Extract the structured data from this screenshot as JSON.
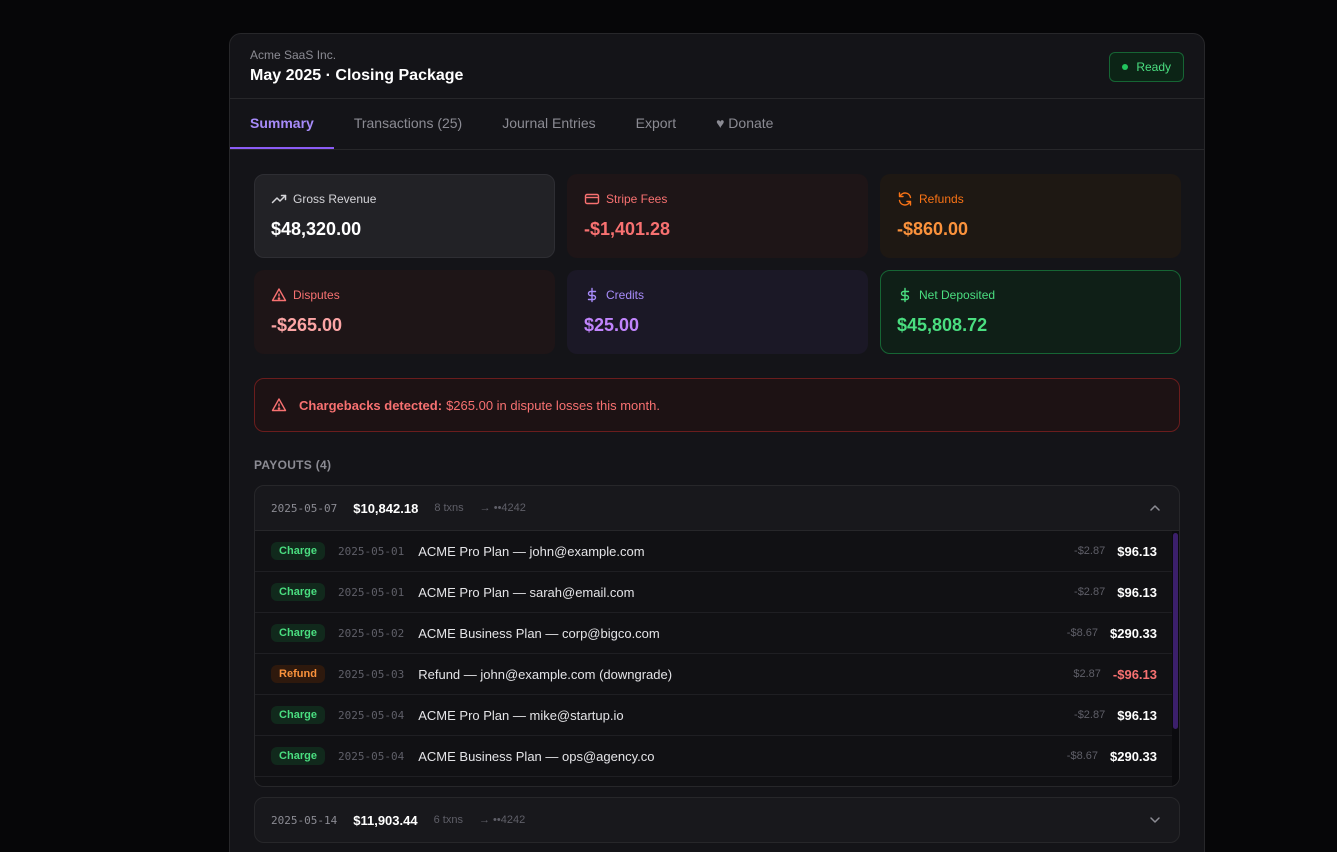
{
  "header": {
    "company": "Acme SaaS Inc.",
    "title": "May 2025 · Closing Package",
    "status": "Ready"
  },
  "tabs": [
    {
      "label": "Summary",
      "active": true
    },
    {
      "label": "Transactions (25)",
      "active": false
    },
    {
      "label": "Journal Entries",
      "active": false
    },
    {
      "label": "Export",
      "active": false
    },
    {
      "label": "♥ Donate",
      "active": false
    }
  ],
  "cards": {
    "gross": {
      "label": "Gross Revenue",
      "value": "$48,320.00",
      "icon": "trending-up-icon"
    },
    "fees": {
      "label": "Stripe Fees",
      "value": "-$1,401.28",
      "icon": "credit-card-icon"
    },
    "refunds": {
      "label": "Refunds",
      "value": "-$860.00",
      "icon": "refresh-icon"
    },
    "disputes": {
      "label": "Disputes",
      "value": "-$265.00",
      "icon": "warning-icon"
    },
    "credits": {
      "label": "Credits",
      "value": "$25.00",
      "icon": "dollar-icon"
    },
    "net": {
      "label": "Net Deposited",
      "value": "$45,808.72",
      "icon": "dollar-icon"
    }
  },
  "alert": {
    "title": "Chargebacks detected:",
    "message": "$265.00 in dispute losses this month."
  },
  "payouts_section": {
    "label": "PAYOUTS (4)"
  },
  "payouts": [
    {
      "date": "2025-05-07",
      "amount": "$10,842.18",
      "txns": "8 txns",
      "account": "→ ••4242",
      "expanded": true,
      "rows": [
        {
          "type": "Charge",
          "date": "2025-05-01",
          "desc": "ACME Pro Plan — john@example.com",
          "fee": "-$2.87",
          "amount": "$96.13"
        },
        {
          "type": "Charge",
          "date": "2025-05-01",
          "desc": "ACME Pro Plan — sarah@email.com",
          "fee": "-$2.87",
          "amount": "$96.13"
        },
        {
          "type": "Charge",
          "date": "2025-05-02",
          "desc": "ACME Business Plan — corp@bigco.com",
          "fee": "-$8.67",
          "amount": "$290.33"
        },
        {
          "type": "Refund",
          "date": "2025-05-03",
          "desc": "Refund — john@example.com (downgrade)",
          "fee": "$2.87",
          "amount": "-$96.13"
        },
        {
          "type": "Charge",
          "date": "2025-05-04",
          "desc": "ACME Pro Plan — mike@startup.io",
          "fee": "-$2.87",
          "amount": "$96.13"
        },
        {
          "type": "Charge",
          "date": "2025-05-04",
          "desc": "ACME Business Plan — ops@agency.co",
          "fee": "-$8.67",
          "amount": "$290.33"
        }
      ]
    },
    {
      "date": "2025-05-14",
      "amount": "$11,903.44",
      "txns": "6 txns",
      "account": "→ ••4242",
      "expanded": false
    }
  ],
  "colors": {
    "accent": "#8b5cf6",
    "success": "#22c55e",
    "danger": "#f87171",
    "warning": "#f97316"
  }
}
